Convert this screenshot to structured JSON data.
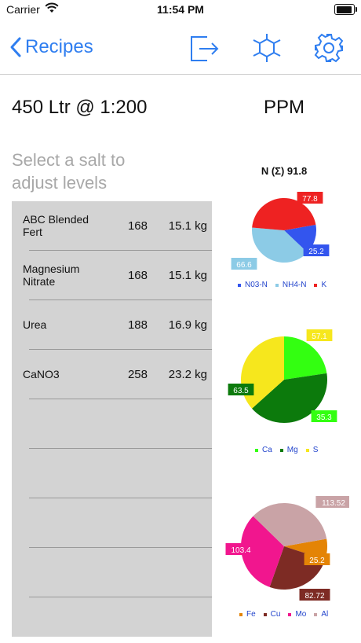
{
  "status_bar": {
    "carrier": "Carrier",
    "time": "11:54 PM"
  },
  "nav": {
    "back_label": "Recipes",
    "icons": [
      "export-icon",
      "molecule-icon",
      "gear-icon"
    ],
    "accent": "#2f7ef0"
  },
  "header": {
    "title": "450 Ltr @ 1:200",
    "ppm_title": "PPM"
  },
  "hint": "Select a salt to adjust levels",
  "salts": [
    {
      "name": "ABC Blended Fert",
      "ratio": "168",
      "weight": "15.1 kg"
    },
    {
      "name": "Magnesium Nitrate",
      "ratio": "168",
      "weight": "15.1 kg"
    },
    {
      "name": "Urea",
      "ratio": "188",
      "weight": "16.9 kg"
    },
    {
      "name": "CaNO3",
      "ratio": "258",
      "weight": "23.2 kg"
    }
  ],
  "chart_data": [
    {
      "type": "pie",
      "title": "N (Σ) 91.8",
      "slices": [
        {
          "label": "NO3-N",
          "value": 25.2,
          "color": "#3355ee"
        },
        {
          "label": "NH4-N",
          "value": 66.6,
          "color": "#8ccbe6"
        },
        {
          "label": "K",
          "value": 77.8,
          "color": "#ee2222"
        }
      ],
      "legend": [
        "N03-N",
        "NH4-N",
        "K"
      ],
      "value_labels": [
        "25.2",
        "66.6",
        "77.8"
      ]
    },
    {
      "type": "pie",
      "title": "",
      "slices": [
        {
          "label": "Ca",
          "value": 35.3,
          "color": "#33ff11"
        },
        {
          "label": "Mg",
          "value": 63.5,
          "color": "#0c7a0c"
        },
        {
          "label": "S",
          "value": 57.1,
          "color": "#f6e71d"
        }
      ],
      "legend": [
        "Ca",
        "Mg",
        "S"
      ],
      "value_labels": [
        "35.3",
        "63.5",
        "57.1"
      ]
    },
    {
      "type": "pie",
      "title": "",
      "slices": [
        {
          "label": "Fe",
          "value": 25.2,
          "color": "#e48406"
        },
        {
          "label": "Cu",
          "value": 82.72,
          "color": "#7d2b24"
        },
        {
          "label": "Mo",
          "value": 103.4,
          "color": "#f1168e"
        },
        {
          "label": "Al",
          "value": 113.52,
          "color": "#c9a3a6"
        }
      ],
      "legend": [
        "Fe",
        "Cu",
        "Mo",
        "Al"
      ],
      "value_labels": [
        "25.2",
        "82.72",
        "103.4",
        "113.52"
      ]
    }
  ]
}
